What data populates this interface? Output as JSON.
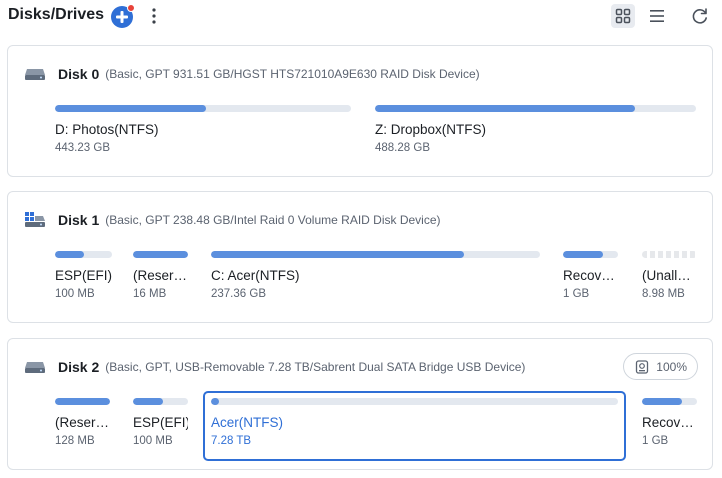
{
  "header": {
    "title": "Disks/Drives"
  },
  "colors": {
    "accent": "#2f6fd6",
    "bar_fill": "#5b8fde",
    "bar_track": "#e3e8ef",
    "card_border": "#dde1e6"
  },
  "disks": [
    {
      "name": "Disk 0",
      "info": "(Basic, GPT 931.51 GB/HGST HTS721010A9E630 RAID Disk Device)",
      "icon": "hard-drive-icon",
      "partitions": [
        {
          "label": "D: Photos(NTFS)",
          "size": "443.23 GB",
          "used_fraction": 0.51
        },
        {
          "label": "Z: Dropbox(NTFS)",
          "size": "488.28 GB",
          "used_fraction": 0.81
        }
      ]
    },
    {
      "name": "Disk 1",
      "info": "(Basic, GPT 238.48 GB/Intel   Raid 0 Volume RAID Disk Device)",
      "icon": "raid-drive-icon",
      "partitions": [
        {
          "label": "ESP(EFI)",
          "size": "100 MB",
          "used_fraction": 0.5
        },
        {
          "label": "(Reser…",
          "size": "16 MB",
          "used_fraction": 1.0
        },
        {
          "label": "C: Acer(NTFS)",
          "size": "237.36 GB",
          "used_fraction": 0.77
        },
        {
          "label": "Recov…",
          "size": "1 GB",
          "used_fraction": 0.72
        },
        {
          "label": "(Unall…",
          "size": "8.98 MB",
          "used_fraction": 0
        }
      ]
    },
    {
      "name": "Disk 2",
      "info": "(Basic, GPT, USB-Removable 7.28 TB/Sabrent  Dual SATA Bridge USB Device)",
      "icon": "hard-drive-icon",
      "badge": "100%",
      "partitions": [
        {
          "label": "(Reser…",
          "size": "128 MB",
          "used_fraction": 1.0
        },
        {
          "label": "ESP(EFI)",
          "size": "100 MB",
          "used_fraction": 0.55
        },
        {
          "label": "Acer(NTFS)",
          "size": "7.28 TB",
          "used_fraction": 0.02
        },
        {
          "label": "Recov…",
          "size": "1 GB",
          "used_fraction": 0.72
        }
      ]
    }
  ]
}
